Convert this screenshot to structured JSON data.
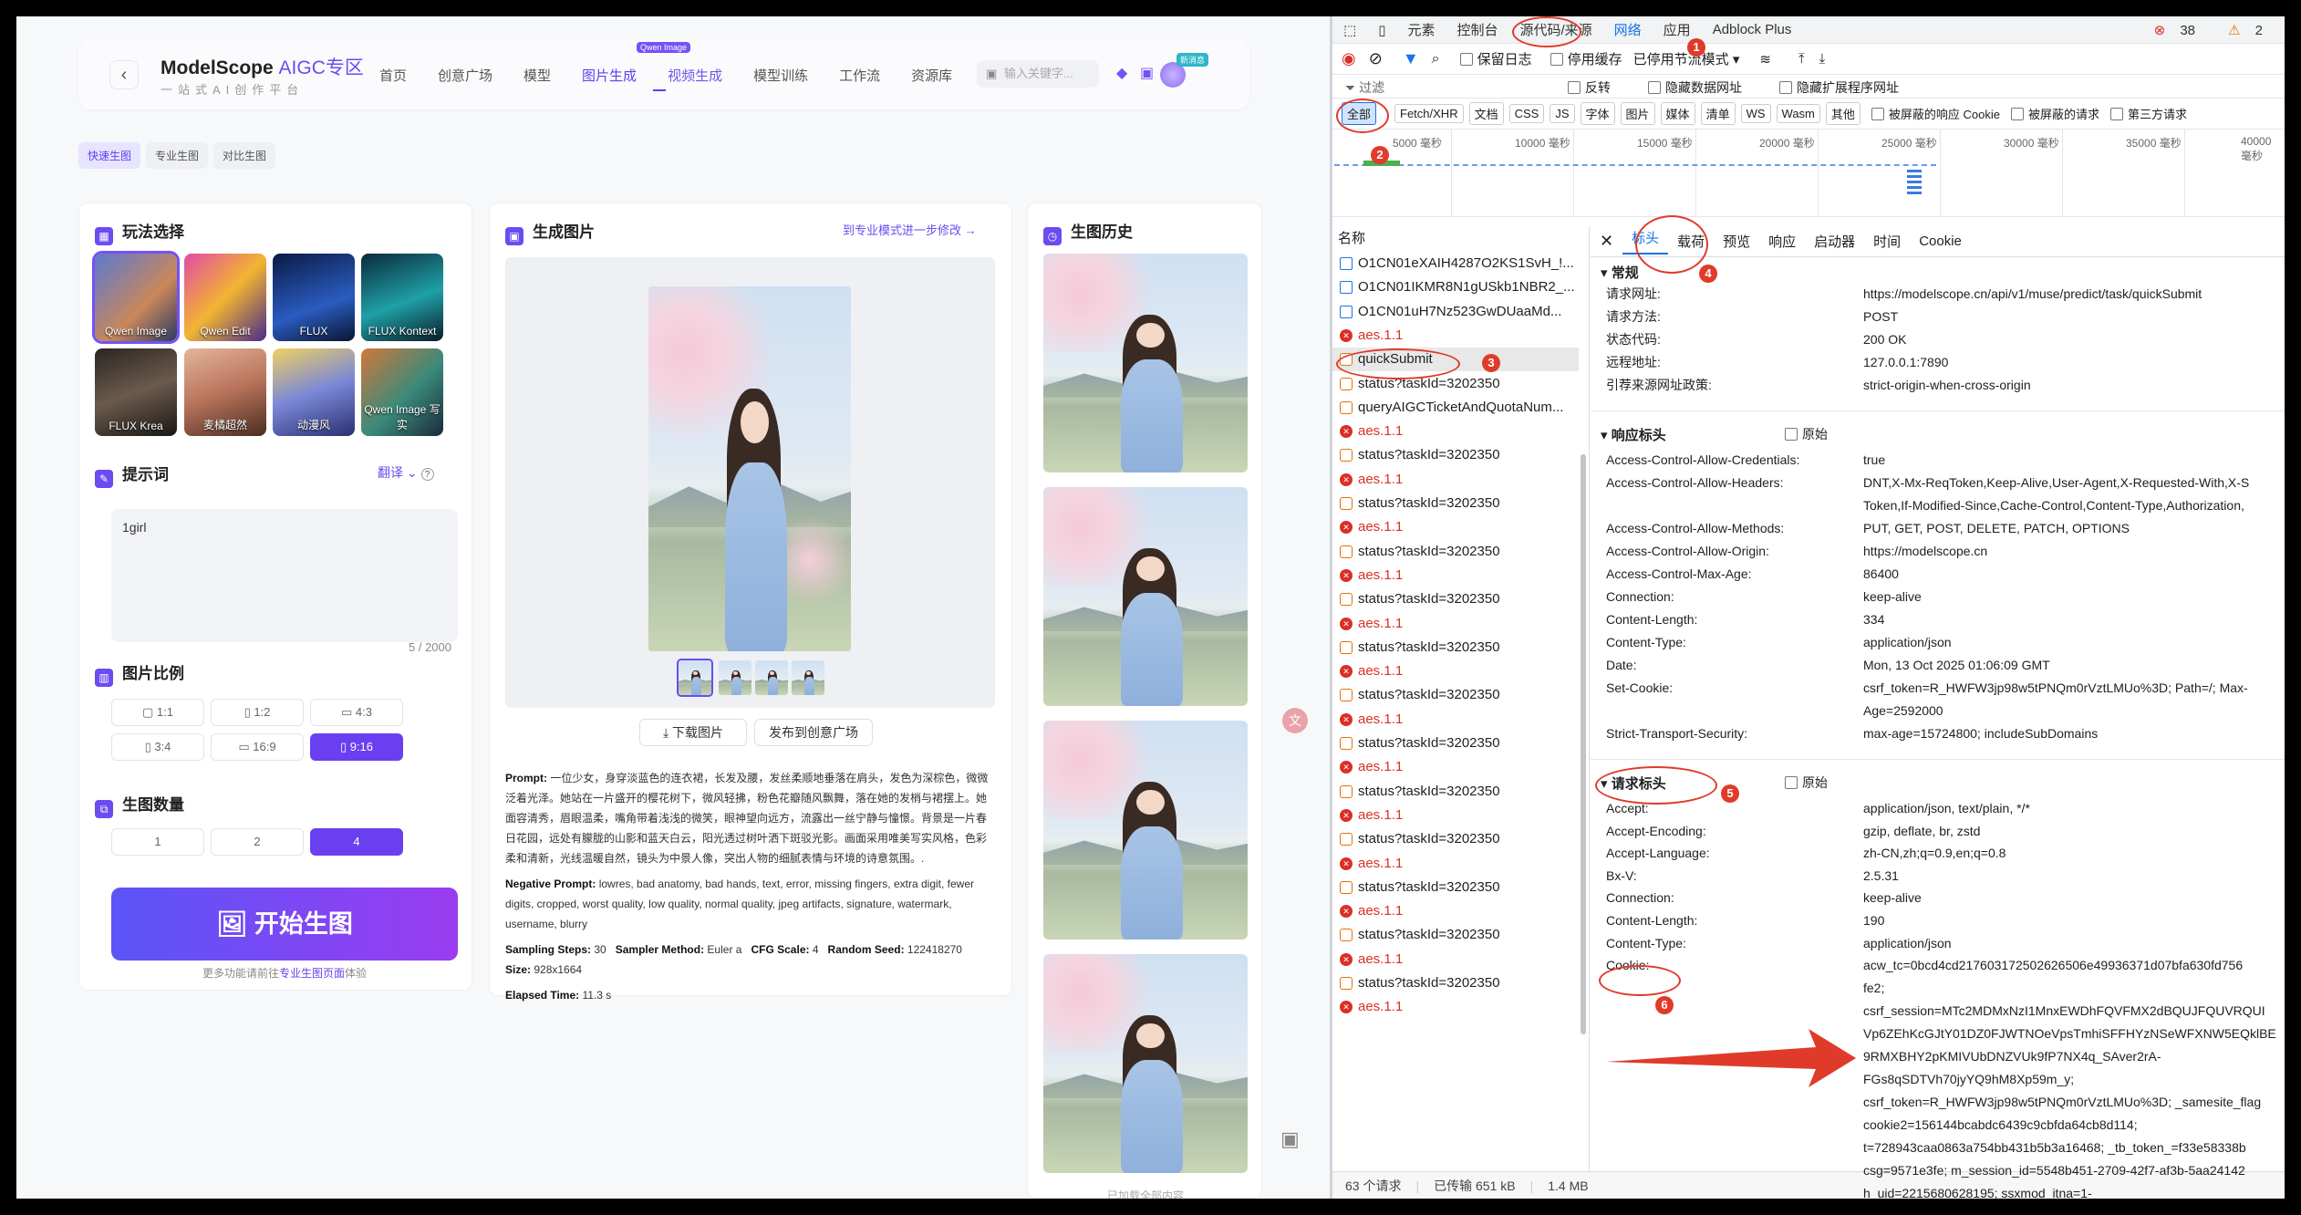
{
  "header": {
    "logo": "ModelScope",
    "logo_sub": "AIGC专区",
    "slogan": "一站式AI创作平台",
    "nav": [
      "首页",
      "创意广场",
      "模型",
      "图片生成",
      "视频生成",
      "模型训练",
      "工作流",
      "资源库"
    ],
    "nav_tag": "Qwen Image",
    "search_placeholder": "输入关键字...",
    "new_tag": "新消息"
  },
  "modes": [
    "快速生图",
    "专业生图",
    "对比生图"
  ],
  "left": {
    "title": "玩法选择",
    "styles": [
      "Qwen Image",
      "Qwen Edit",
      "FLUX",
      "FLUX Kontext",
      "FLUX Krea",
      "麦橘超然",
      "动漫风",
      "Qwen Image 写实"
    ],
    "prompt_title": "提示词",
    "translate": "翻译",
    "prompt_value": "1girl",
    "counter": "5 / 2000",
    "ratio_title": "图片比例",
    "ratios": [
      "1:1",
      "1:2",
      "4:3",
      "3:4",
      "16:9",
      "9:16"
    ],
    "count_title": "生图数量",
    "counts": [
      "1",
      "2",
      "4"
    ],
    "generate": "开始生图",
    "tip_prefix": "更多功能请前往",
    "tip_link": "专业生图页面",
    "tip_suffix": "体验"
  },
  "mid": {
    "title": "生成图片",
    "link": "到专业模式进一步修改 →",
    "download": "下载图片",
    "publish": "发布到创意广场",
    "prompt_label": "Prompt:",
    "prompt": "一位少女，身穿淡蓝色的连衣裙，长发及腰，发丝柔顺地垂落在肩头，发色为深棕色，微微泛着光泽。她站在一片盛开的樱花树下，微风轻拂，粉色花瓣随风飘舞，落在她的发梢与裙摆上。她面容清秀，眉眼温柔，嘴角带着浅浅的微笑，眼神望向远方，流露出一丝宁静与憧憬。背景是一片春日花园，远处有朦胧的山影和蓝天白云，阳光透过树叶洒下斑驳光影。画面采用唯美写实风格，色彩柔和清新，光线温暖自然，镜头为中景人像，突出人物的细腻表情与环境的诗意氛围。.",
    "neg_label": "Negative Prompt:",
    "neg": "lowres, bad anatomy, bad hands, text, error, missing fingers, extra digit, fewer digits, cropped, worst quality, low quality, normal quality, jpeg artifacts, signature, watermark, username, blurry",
    "steps_label": "Sampling Steps:",
    "steps": "30",
    "sampler_label": "Sampler Method:",
    "sampler": "Euler a",
    "cfg_label": "CFG Scale:",
    "cfg": "4",
    "seed_label": "Random Seed:",
    "seed": "122418270",
    "size_label": "Size:",
    "size": "928x1664",
    "elapsed_label": "Elapsed Time:",
    "elapsed": "11.3 s"
  },
  "history": {
    "title": "生图历史",
    "footer": "已加载全部内容"
  },
  "devtools": {
    "tabs": [
      "元素",
      "控制台",
      "源代码/来源",
      "网络",
      "应用",
      "Adblock Plus"
    ],
    "errors": "38",
    "warnings": "2",
    "tool": {
      "preserve": "保留日志",
      "disable_cache": "停用缓存",
      "throttle": "已停用节流模式"
    },
    "filter": "过滤",
    "invert": "反转",
    "hide_data": "隐藏数据网址",
    "hide_ext": "隐藏扩展程序网址",
    "types": [
      "全部",
      "Fetch/XHR",
      "文档",
      "CSS",
      "JS",
      "字体",
      "图片",
      "媒体",
      "清单",
      "WS",
      "Wasm",
      "其他"
    ],
    "blocked_cookie": "被屏蔽的响应 Cookie",
    "blocked_req": "被屏蔽的请求",
    "third_party": "第三方请求",
    "timeline": [
      "5000 毫秒",
      "10000 毫秒",
      "15000 毫秒",
      "20000 毫秒",
      "25000 毫秒",
      "30000 毫秒",
      "35000 毫秒",
      "40000 毫秒"
    ],
    "name_header": "名称",
    "requests": [
      {
        "name": "O1CN01eXAIH4287O2KS1SvH_!...",
        "t": "doc"
      },
      {
        "name": "O1CN01IKMR8N1gUSkb1NBR2_...",
        "t": "doc"
      },
      {
        "name": "O1CN01uH7Nz523GwDUaaMd...",
        "t": "doc"
      },
      {
        "name": "aes.1.1",
        "t": "err"
      },
      {
        "name": "quickSubmit",
        "t": "sel"
      },
      {
        "name": "status?taskId=3202350",
        "t": "ok"
      },
      {
        "name": "queryAIGCTicketAndQuotaNum...",
        "t": "ok"
      },
      {
        "name": "aes.1.1",
        "t": "err"
      },
      {
        "name": "status?taskId=3202350",
        "t": "ok"
      },
      {
        "name": "aes.1.1",
        "t": "err"
      },
      {
        "name": "status?taskId=3202350",
        "t": "ok"
      },
      {
        "name": "aes.1.1",
        "t": "err"
      },
      {
        "name": "status?taskId=3202350",
        "t": "ok"
      },
      {
        "name": "aes.1.1",
        "t": "err"
      },
      {
        "name": "status?taskId=3202350",
        "t": "ok"
      },
      {
        "name": "aes.1.1",
        "t": "err"
      },
      {
        "name": "status?taskId=3202350",
        "t": "ok"
      },
      {
        "name": "aes.1.1",
        "t": "err"
      },
      {
        "name": "status?taskId=3202350",
        "t": "ok"
      },
      {
        "name": "aes.1.1",
        "t": "err"
      },
      {
        "name": "status?taskId=3202350",
        "t": "ok"
      },
      {
        "name": "aes.1.1",
        "t": "err"
      },
      {
        "name": "status?taskId=3202350",
        "t": "ok"
      },
      {
        "name": "aes.1.1",
        "t": "err"
      },
      {
        "name": "status?taskId=3202350",
        "t": "ok"
      },
      {
        "name": "aes.1.1",
        "t": "err"
      },
      {
        "name": "status?taskId=3202350",
        "t": "ok"
      },
      {
        "name": "aes.1.1",
        "t": "err"
      },
      {
        "name": "status?taskId=3202350",
        "t": "ok"
      },
      {
        "name": "aes.1.1",
        "t": "err"
      },
      {
        "name": "status?taskId=3202350",
        "t": "ok"
      },
      {
        "name": "aes.1.1",
        "t": "err"
      }
    ],
    "status": {
      "requests": "63 个请求",
      "transferred": "已传输 651 kB",
      "resources": "1.4 MB"
    },
    "detail_tabs": [
      "标头",
      "载荷",
      "预览",
      "响应",
      "启动器",
      "时间",
      "Cookie"
    ],
    "general_title": "常规",
    "raw": "原始",
    "general": [
      [
        "请求网址:",
        "https://modelscope.cn/api/v1/muse/predict/task/quickSubmit"
      ],
      [
        "请求方法:",
        "POST"
      ],
      [
        "状态代码:",
        "200 OK"
      ],
      [
        "远程地址:",
        "127.0.0.1:7890"
      ],
      [
        "引荐来源网址政策:",
        "strict-origin-when-cross-origin"
      ]
    ],
    "resp_title": "响应标头",
    "resp": [
      [
        "Access-Control-Allow-Credentials:",
        "true"
      ],
      [
        "Access-Control-Allow-Headers:",
        "DNT,X-Mx-ReqToken,Keep-Alive,User-Agent,X-Requested-With,X-S\nToken,If-Modified-Since,Cache-Control,Content-Type,Authorization,"
      ],
      [
        "Access-Control-Allow-Methods:",
        "PUT, GET, POST, DELETE, PATCH, OPTIONS"
      ],
      [
        "Access-Control-Allow-Origin:",
        "https://modelscope.cn"
      ],
      [
        "Access-Control-Max-Age:",
        "86400"
      ],
      [
        "Connection:",
        "keep-alive"
      ],
      [
        "Content-Length:",
        "334"
      ],
      [
        "Content-Type:",
        "application/json"
      ],
      [
        "Date:",
        "Mon, 13 Oct 2025 01:06:09 GMT"
      ],
      [
        "Set-Cookie:",
        "csrf_token=R_HWFW3jp98w5tPNQm0rVztLMUo%3D; Path=/; Max-\nAge=2592000"
      ],
      [
        "Strict-Transport-Security:",
        "max-age=15724800; includeSubDomains"
      ]
    ],
    "req_title": "请求标头",
    "req": [
      [
        "Accept:",
        "application/json, text/plain, */*"
      ],
      [
        "Accept-Encoding:",
        "gzip, deflate, br, zstd"
      ],
      [
        "Accept-Language:",
        "zh-CN,zh;q=0.9,en;q=0.8"
      ],
      [
        "Bx-V:",
        "2.5.31"
      ],
      [
        "Connection:",
        "keep-alive"
      ],
      [
        "Content-Length:",
        "190"
      ],
      [
        "Content-Type:",
        "application/json"
      ],
      [
        "Cookie:",
        "acw_tc=0bcd4cd217603172502626506e49936371d07bfa630fd756\nfe2;\ncsrf_session=MTc2MDMxNzI1MnxEWDhFQVFMX2dBQUJFQUVRQUI\nVp6ZEhKcGJtY01DZ0FJWTNOeVpsTmhiSFFHYzNSeWFXNW5EQklBE\n9RMXBHY2pKMIVUbDNZVUk9fP7NX4q_SAver2rA-\nFGs8qSDTVh70jyYQ9hM8Xp59m_y;\ncsrf_token=R_HWFW3jp98w5tPNQm0rVztLMUo%3D; _samesite_flag\ncookie2=156144bcabdc6439c9cbfda64cb8d114;\nt=728943caa0863a754bb431b5b3a16468; _tb_token_=f33e58338b\ncsg=9571e3fe; m_session_id=5548b451-2709-42f7-af3b-5aa24142\nh_uid=2215680628195; ssxmod_itna=1-"
      ]
    ]
  },
  "annotations": [
    "1",
    "2",
    "3",
    "4",
    "5",
    "6"
  ],
  "colors": {
    "accent": "#6a4cf0",
    "red": "#e03b2a",
    "blue": "#1a73e8"
  }
}
